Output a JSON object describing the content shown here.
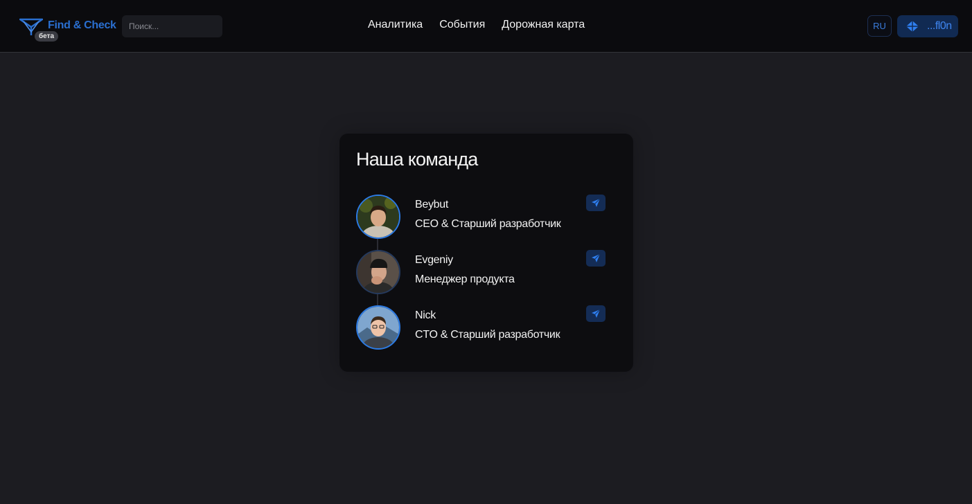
{
  "header": {
    "logo_text": "Find & Check",
    "beta_label": "бета",
    "search_placeholder": "Поиск...",
    "nav": [
      "Аналитика",
      "События",
      "Дорожная карта"
    ],
    "lang": "RU",
    "wallet_label": "...fl0n"
  },
  "team": {
    "title": "Наша команда",
    "members": [
      {
        "name": "Beybut",
        "role": "CEO & Старший разработчик",
        "contact_icon": "telegram-icon"
      },
      {
        "name": "Evgeniy",
        "role": "Менеджер продукта",
        "contact_icon": "telegram-icon"
      },
      {
        "name": "Nick",
        "role": "CTO & Старший разработчик",
        "contact_icon": "telegram-icon"
      }
    ]
  },
  "colors": {
    "accent": "#2c7be5",
    "background": "#1c1c21",
    "header": "#0b0b0e",
    "card": "#0d0d10"
  }
}
